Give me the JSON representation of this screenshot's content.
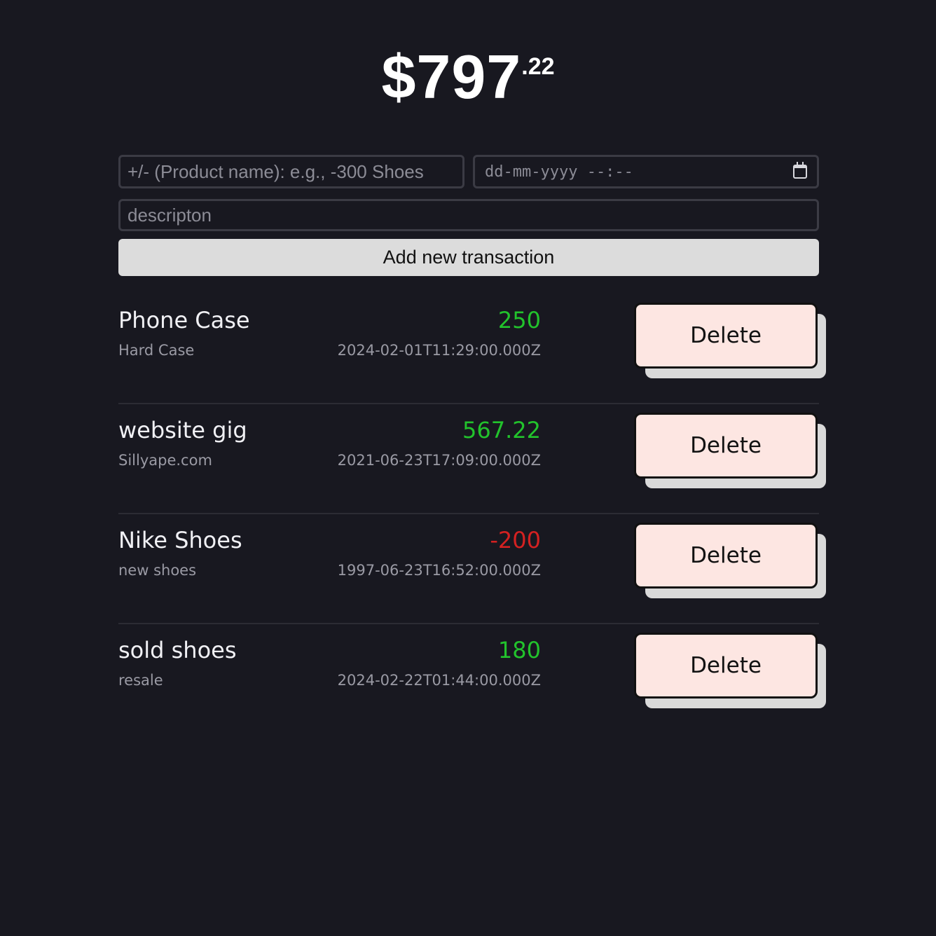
{
  "balance": {
    "dollars": "$797",
    "cents": ".22"
  },
  "form": {
    "name_placeholder": "+/- (Product name): e.g., -300 Shoes",
    "datetime_placeholder": "dd-mm-yyyy --:--",
    "description_placeholder": "descripton",
    "add_button_label": "Add new transaction"
  },
  "colors": {
    "positive": "#22c32c",
    "negative": "#d42121",
    "delete_bg": "#fde6e2"
  },
  "transactions": [
    {
      "name": "Phone Case",
      "description": "Hard Case",
      "amount": "250",
      "datetime": "2024-02-01T11:29:00.000Z",
      "sign": "pos",
      "delete_label": "Delete"
    },
    {
      "name": "website gig",
      "description": "Sillyape.com",
      "amount": "567.22",
      "datetime": "2021-06-23T17:09:00.000Z",
      "sign": "pos",
      "delete_label": "Delete"
    },
    {
      "name": "Nike Shoes",
      "description": "new shoes",
      "amount": "-200",
      "datetime": "1997-06-23T16:52:00.000Z",
      "sign": "neg",
      "delete_label": "Delete"
    },
    {
      "name": "sold shoes",
      "description": "resale",
      "amount": "180",
      "datetime": "2024-02-22T01:44:00.000Z",
      "sign": "pos",
      "delete_label": "Delete"
    }
  ]
}
